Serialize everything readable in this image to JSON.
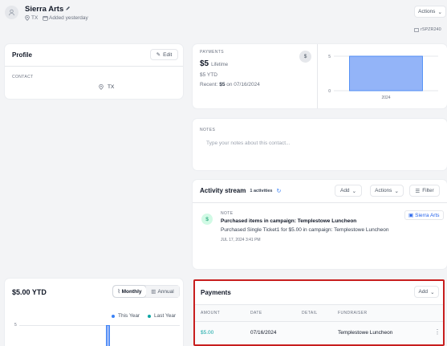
{
  "contact": {
    "name": "Sierra Arts",
    "location": "TX",
    "added": "Added yesterday",
    "id_tag": "rSPZR240"
  },
  "header": {
    "actions_label": "Actions"
  },
  "profile": {
    "title": "Profile",
    "edit_label": "Edit",
    "contact_section": "CONTACT",
    "location": "TX"
  },
  "payments_summary": {
    "section_label": "PAYMENTS",
    "lifetime_amount": "$5",
    "lifetime_label": "Lifetime",
    "ytd": "$5 YTD",
    "recent_prefix": "Recent:",
    "recent_amount": "$5",
    "recent_suffix": "on 07/16/2024",
    "badge": "$"
  },
  "chart_data": {
    "type": "bar",
    "categories": [
      "2024"
    ],
    "values": [
      5
    ],
    "ylim": [
      0,
      5
    ],
    "yticks": [
      "5",
      "0"
    ],
    "color": "#93b4f8"
  },
  "notes": {
    "label": "NOTES",
    "placeholder": "Type your notes about this contact..."
  },
  "activity": {
    "title": "Activity stream",
    "count": "1 activities",
    "add_label": "Add",
    "actions_label": "Actions",
    "filter_label": "Filter",
    "items": [
      {
        "type": "NOTE",
        "title": "Purchased items in campaign: Templestowe Luncheon",
        "body": "Purchased Single Ticket1 for $5.00 in campaign: Templestowe Luncheon",
        "timestamp": "JUL 17, 2024 3:41 PM",
        "author": "Sierra Arts",
        "icon_letter": "$"
      }
    ]
  },
  "ytd_card": {
    "title": "$5.00 YTD",
    "monthly_label": "Monthly",
    "annual_label": "Annual",
    "legend_this_year": "This Year",
    "legend_last_year": "Last Year",
    "ytick": "5"
  },
  "payments_table": {
    "title": "Payments",
    "add_label": "Add",
    "columns": [
      "AMOUNT",
      "DATE",
      "DETAIL",
      "FUNDRAISER"
    ],
    "rows": [
      {
        "amount": "$5.00",
        "date": "07/16/2024",
        "detail": "",
        "fundraiser": "Templestowe Luncheon"
      }
    ]
  },
  "colors": {
    "accent": "#2563eb",
    "teal": "#0ea5a4",
    "highlight": "#c81e1e"
  }
}
